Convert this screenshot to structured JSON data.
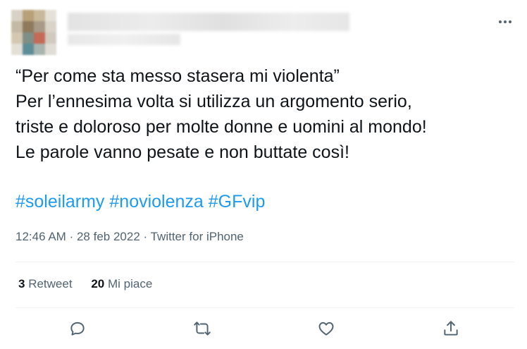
{
  "tweet": {
    "text_lines": [
      "“Per come sta messo stasera mi violenta”",
      "Per l’ennesima volta si utilizza un argomento serio,",
      "triste e doloroso per molte donne e uomini al mondo!",
      "Le parole vanno pesate e non buttate così!"
    ],
    "hashtags": [
      "#soleilarmy",
      "#noviolenza",
      "#GFvip"
    ],
    "time": "12:46 AM",
    "separator": "·",
    "date": "28 feb 2022",
    "source": "Twitter for iPhone"
  },
  "stats": {
    "retweet_count": "3",
    "retweet_label": "Retweet",
    "like_count": "20",
    "like_label": "Mi piace"
  },
  "icons": {
    "more": "more-horizontal-icon",
    "reply": "reply-icon",
    "retweet": "retweet-icon",
    "like": "heart-icon",
    "share": "share-icon"
  },
  "colors": {
    "hashtag": "#1d9bf0",
    "text": "#0f1419",
    "secondary": "#536471",
    "divider": "#eff3f4"
  }
}
